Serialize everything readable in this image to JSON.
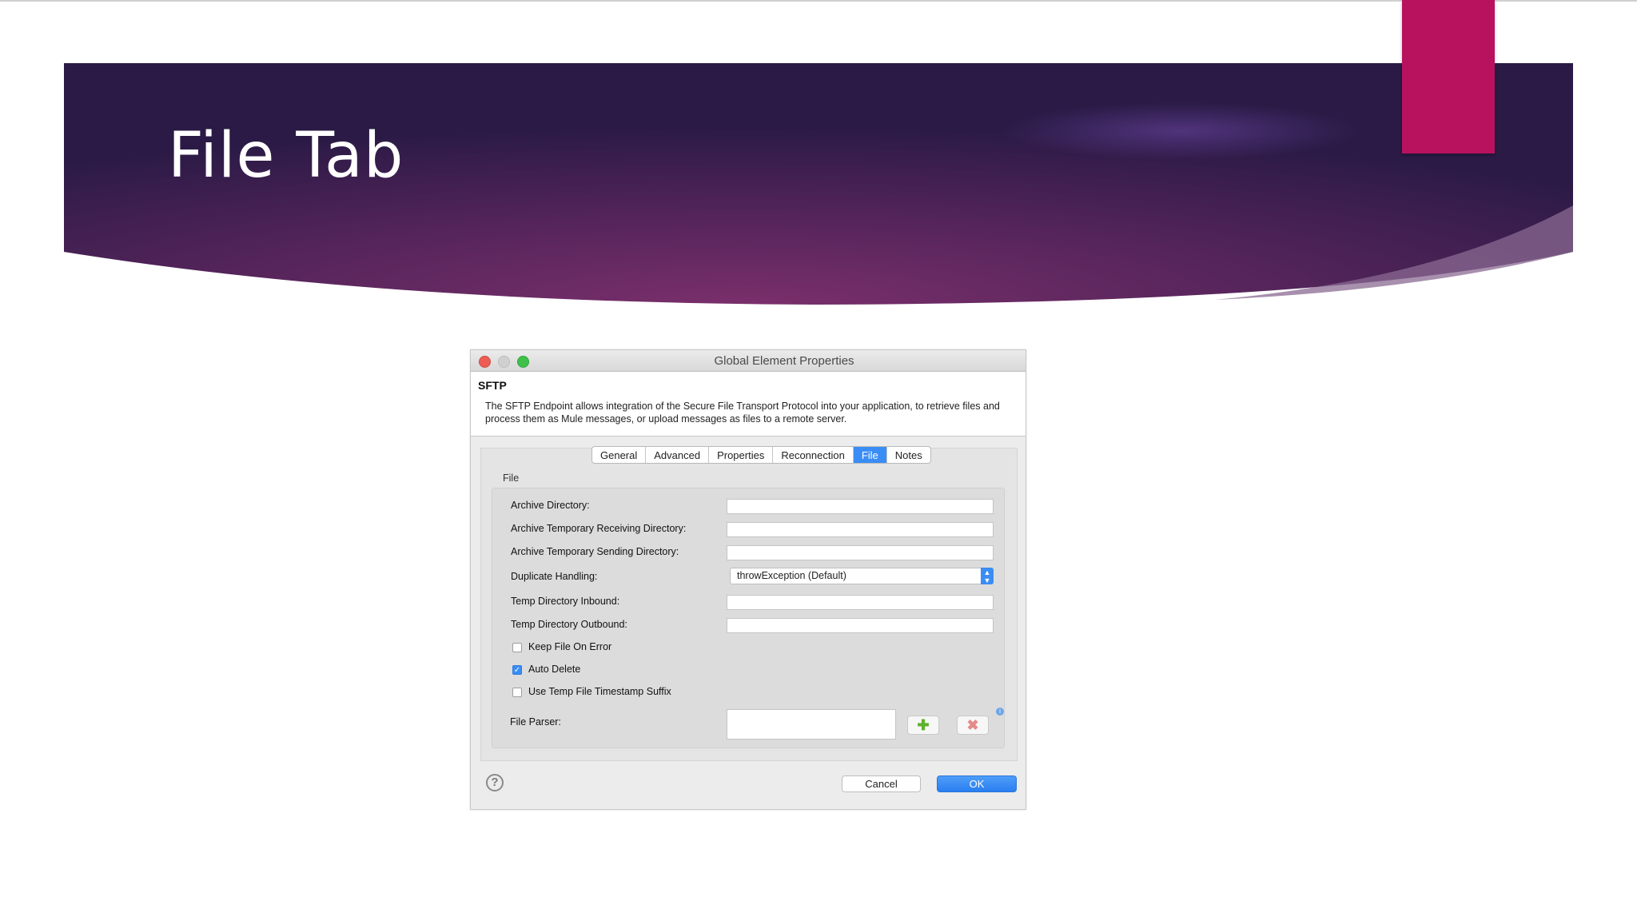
{
  "slide": {
    "title": "File Tab",
    "colors": {
      "banner_dark": "#2d1c49",
      "banner_mid": "#6a2a64",
      "accent": "#b8125e"
    }
  },
  "dialog": {
    "window_title": "Global Element Properties",
    "heading": "SFTP",
    "description": "The SFTP Endpoint allows integration of the Secure File Transport Protocol into your application, to retrieve files and process them as Mule messages, or upload messages as files to a remote server.",
    "tabs": [
      {
        "label": "General",
        "active": false
      },
      {
        "label": "Advanced",
        "active": false
      },
      {
        "label": "Properties",
        "active": false
      },
      {
        "label": "Reconnection",
        "active": false
      },
      {
        "label": "File",
        "active": true
      },
      {
        "label": "Notes",
        "active": false
      }
    ],
    "group_label": "File",
    "fields": {
      "archive_directory": {
        "label": "Archive Directory:",
        "value": ""
      },
      "archive_temp_receiving": {
        "label": "Archive Temporary Receiving Directory:",
        "value": ""
      },
      "archive_temp_sending": {
        "label": "Archive Temporary Sending Directory:",
        "value": ""
      },
      "duplicate_handling": {
        "label": "Duplicate Handling:",
        "value": "throwException (Default)"
      },
      "temp_dir_inbound": {
        "label": "Temp Directory Inbound:",
        "value": ""
      },
      "temp_dir_outbound": {
        "label": "Temp Directory Outbound:",
        "value": ""
      },
      "file_parser": {
        "label": "File Parser:",
        "value": ""
      }
    },
    "checkboxes": {
      "keep_file_on_error": {
        "label": "Keep File On Error",
        "checked": false
      },
      "auto_delete": {
        "label": "Auto Delete",
        "checked": true
      },
      "use_temp_timestamp": {
        "label": "Use Temp File Timestamp Suffix",
        "checked": false
      }
    },
    "icons": {
      "add": "plus-icon",
      "remove": "x-icon",
      "info": "info-icon",
      "help": "question-icon",
      "dropdown": "updown-arrows-icon"
    },
    "buttons": {
      "cancel": "Cancel",
      "ok": "OK"
    }
  }
}
